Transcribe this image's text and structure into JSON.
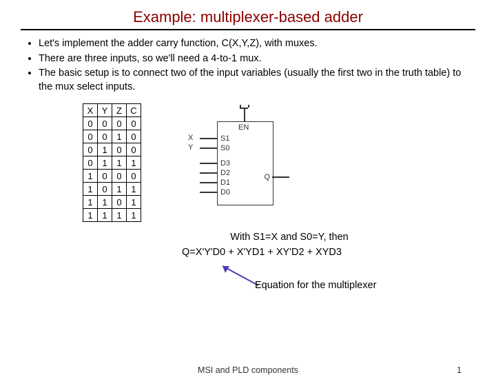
{
  "title": "Example: multiplexer-based adder",
  "bullets": [
    "Let's implement the adder carry function, C(X,Y,Z), with muxes.",
    "There are three inputs, so we'll need a 4-to-1 mux.",
    "The basic setup is to connect two of the input variables (usually the first two in the truth table) to the mux select inputs."
  ],
  "truth": {
    "headers": [
      "X",
      "Y",
      "Z",
      "C"
    ],
    "rows": [
      [
        "0",
        "0",
        "0",
        "0"
      ],
      [
        "0",
        "0",
        "1",
        "0"
      ],
      [
        "0",
        "1",
        "0",
        "0"
      ],
      [
        "0",
        "1",
        "1",
        "1"
      ],
      [
        "1",
        "0",
        "0",
        "0"
      ],
      [
        "1",
        "0",
        "1",
        "1"
      ],
      [
        "1",
        "1",
        "0",
        "1"
      ],
      [
        "1",
        "1",
        "1",
        "1"
      ]
    ]
  },
  "mux": {
    "en": "EN",
    "s1": "S1",
    "s0": "S0",
    "d3": "D3",
    "d2": "D2",
    "d1": "D1",
    "d0": "D0",
    "q": "Q",
    "x": "X",
    "y": "Y"
  },
  "eq": {
    "line1": "With S1=X and S0=Y, then",
    "line2": "Q=X'Y'D0 + X'YD1 + XY'D2 + XYD3",
    "label": "Equation for the multiplexer"
  },
  "footer": {
    "center": "MSI and PLD components",
    "page": "1"
  }
}
